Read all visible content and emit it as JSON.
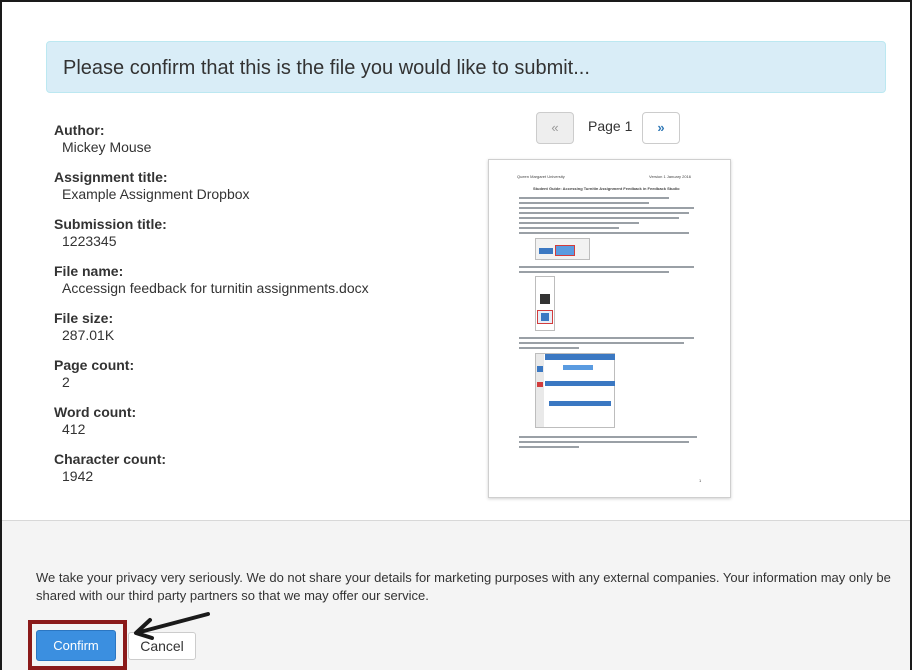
{
  "banner": {
    "text": "Please confirm that this is the file you would like to submit..."
  },
  "details": [
    {
      "label": "Author:",
      "value": "Mickey Mouse"
    },
    {
      "label": "Assignment title:",
      "value": "Example Assignment Dropbox"
    },
    {
      "label": "Submission title:",
      "value": "1223345"
    },
    {
      "label": "File name:",
      "value": "Accessign feedback for turnitin assignments.docx"
    },
    {
      "label": "File size:",
      "value": "287.01K"
    },
    {
      "label": "Page count:",
      "value": "2"
    },
    {
      "label": "Word count:",
      "value": "412"
    },
    {
      "label": "Character count:",
      "value": "1942"
    }
  ],
  "pager": {
    "prev": "«",
    "label": "Page 1",
    "next": "»"
  },
  "preview": {
    "header_left": "Queen Margaret University",
    "header_right": "Version 1 January 2016",
    "doc_title": "Student Guide: Accessing Turnitin Assignment Feedback in Feedback Studio",
    "page_number": "1"
  },
  "footer": {
    "privacy_text": "We take your privacy very seriously. We do not share your details for marketing purposes with any external companies. Your information may only be shared with our third party partners so that we may offer our service.",
    "confirm_label": "Confirm",
    "cancel_label": "Cancel"
  },
  "colors": {
    "banner_bg": "#d9edf7",
    "confirm_bg": "#3b8fe0",
    "highlight": "#8b1a1a"
  }
}
